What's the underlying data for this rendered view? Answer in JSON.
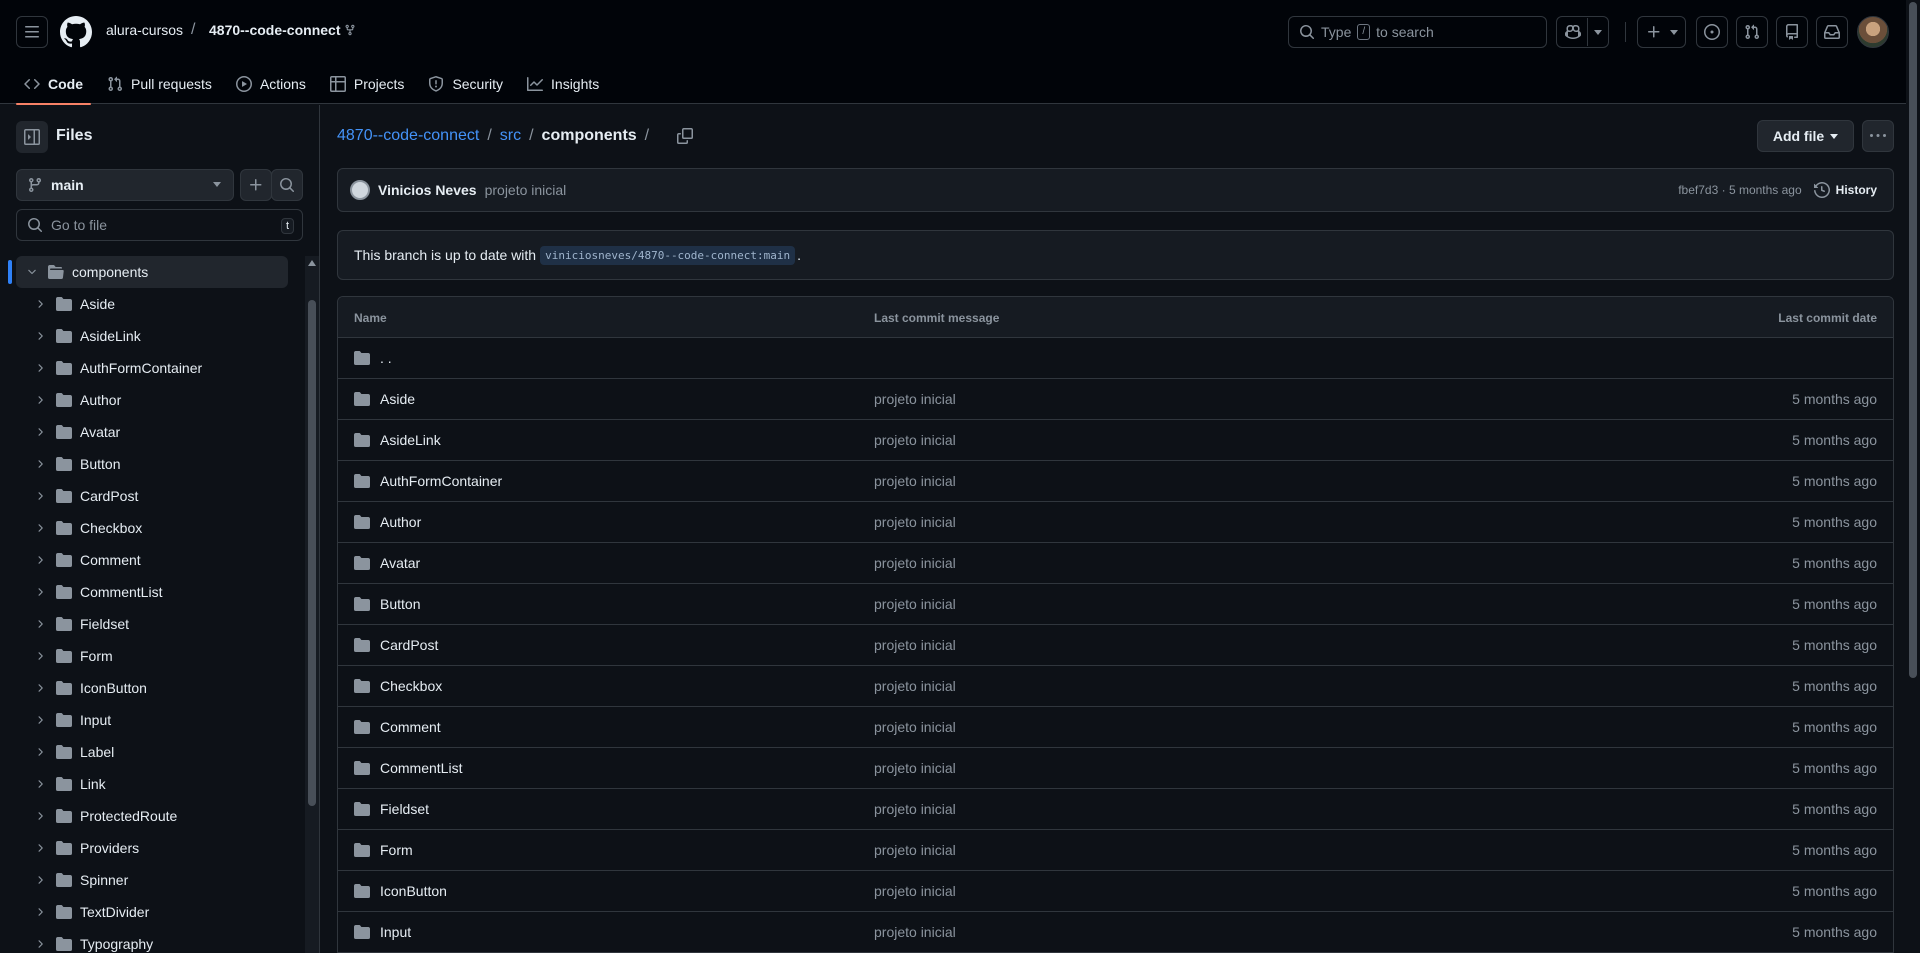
{
  "header": {
    "owner": "alura-cursos",
    "separator": "/",
    "repo": "4870--code-connect",
    "search_placeholder_prefix": "Type",
    "search_key": "/",
    "search_placeholder_suffix": "to search"
  },
  "repo_nav": {
    "tabs": [
      {
        "label": "Code",
        "icon": "code-icon",
        "active": true
      },
      {
        "label": "Pull requests",
        "icon": "pull-request-icon"
      },
      {
        "label": "Actions",
        "icon": "play-icon"
      },
      {
        "label": "Projects",
        "icon": "table-icon"
      },
      {
        "label": "Security",
        "icon": "shield-icon"
      },
      {
        "label": "Insights",
        "icon": "graph-icon"
      }
    ],
    "accent_color": "#f78166"
  },
  "sidebar": {
    "title": "Files",
    "branch": "main",
    "goto_placeholder": "Go to file",
    "goto_key": "t",
    "root_folder": "components",
    "folders": [
      "Aside",
      "AsideLink",
      "AuthFormContainer",
      "Author",
      "Avatar",
      "Button",
      "CardPost",
      "Checkbox",
      "Comment",
      "CommentList",
      "Fieldset",
      "Form",
      "IconButton",
      "Input",
      "Label",
      "Link",
      "ProtectedRoute",
      "Providers",
      "Spinner",
      "TextDivider",
      "Typography"
    ]
  },
  "main": {
    "breadcrumb": {
      "repo": "4870--code-connect",
      "sep": "/",
      "src": "src",
      "current": "components",
      "trailing_sep": "/"
    },
    "add_file_label": "Add file",
    "commit": {
      "author": "Vinicios Neves",
      "message": "projeto inicial",
      "sha": "fbef7d3",
      "dot": "·",
      "time": "5 months ago",
      "history_label": "History"
    },
    "branch_status": {
      "prefix": "This branch is up to date with",
      "ref": "viniciosneves/4870--code-connect:main",
      "suffix": "."
    },
    "table": {
      "headers": {
        "name": "Name",
        "message": "Last commit message",
        "date": "Last commit date"
      },
      "parent_dir": ". .",
      "rows": [
        {
          "name": "Aside",
          "message": "projeto inicial",
          "date": "5 months ago"
        },
        {
          "name": "AsideLink",
          "message": "projeto inicial",
          "date": "5 months ago"
        },
        {
          "name": "AuthFormContainer",
          "message": "projeto inicial",
          "date": "5 months ago"
        },
        {
          "name": "Author",
          "message": "projeto inicial",
          "date": "5 months ago"
        },
        {
          "name": "Avatar",
          "message": "projeto inicial",
          "date": "5 months ago"
        },
        {
          "name": "Button",
          "message": "projeto inicial",
          "date": "5 months ago"
        },
        {
          "name": "CardPost",
          "message": "projeto inicial",
          "date": "5 months ago"
        },
        {
          "name": "Checkbox",
          "message": "projeto inicial",
          "date": "5 months ago"
        },
        {
          "name": "Comment",
          "message": "projeto inicial",
          "date": "5 months ago"
        },
        {
          "name": "CommentList",
          "message": "projeto inicial",
          "date": "5 months ago"
        },
        {
          "name": "Fieldset",
          "message": "projeto inicial",
          "date": "5 months ago"
        },
        {
          "name": "Form",
          "message": "projeto inicial",
          "date": "5 months ago"
        },
        {
          "name": "IconButton",
          "message": "projeto inicial",
          "date": "5 months ago"
        },
        {
          "name": "Input",
          "message": "projeto inicial",
          "date": "5 months ago"
        }
      ]
    }
  }
}
